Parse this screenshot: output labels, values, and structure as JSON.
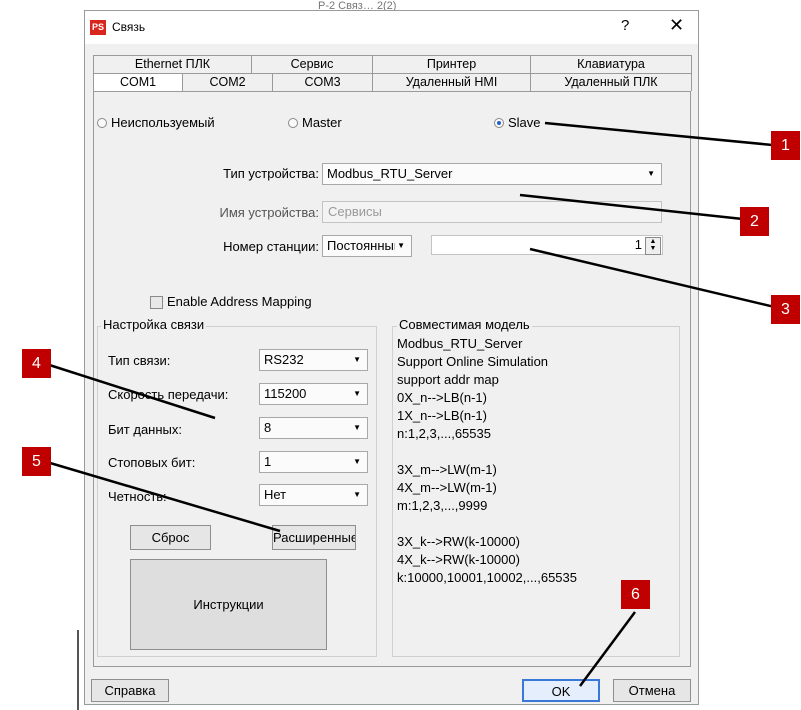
{
  "window": {
    "title": "Связь",
    "help": "?",
    "close": "✕",
    "icon_text": "PS"
  },
  "bg_fragment": "Р-2 Связ… 2(2)",
  "tabs_top": [
    "Ethernet ПЛК",
    "Сервис",
    "Принтер",
    "Клавиатура"
  ],
  "tabs_bottom": [
    "COM1",
    "COM2",
    "COM3",
    "Удаленный HMI",
    "Удаленный ПЛК"
  ],
  "mode": {
    "unused": "Неиспользуемый",
    "master": "Master",
    "slave": "Slave",
    "selected": "Slave"
  },
  "device_type": {
    "label": "Тип устройства:",
    "value": "Modbus_RTU_Server"
  },
  "device_name": {
    "label": "Имя устройства:",
    "value": "Сервисы"
  },
  "station": {
    "label": "Номер станции:",
    "mode": "Постоянный",
    "value": "1"
  },
  "address_mapping": {
    "label": "Enable Address Mapping",
    "checked": false
  },
  "comm_settings": {
    "title": "Настройка связи",
    "type_label": "Тип связи:",
    "type_value": "RS232",
    "baud_label": "Скорость передачи:",
    "baud_value": "115200",
    "databits_label": "Бит данных:",
    "databits_value": "8",
    "stopbits_label": "Стоповых бит:",
    "stopbits_value": "1",
    "parity_label": "Четность:",
    "parity_value": "Нет",
    "reset_button": "Сброс",
    "advanced_button": "Расширенные",
    "instructions_button": "Инструкции"
  },
  "compat": {
    "title": "Совместимая модель",
    "lines": [
      "Modbus_RTU_Server",
      "Support Online Simulation",
      "support addr map",
      "0X_n-->LB(n-1)",
      "1X_n-->LB(n-1)",
      "n:1,2,3,...,65535",
      "",
      "3X_m-->LW(m-1)",
      "4X_m-->LW(m-1)",
      "m:1,2,3,...,9999",
      "",
      "3X_k-->RW(k-10000)",
      "4X_k-->RW(k-10000)",
      "k:10000,10001,10002,...,65535"
    ]
  },
  "footer": {
    "help_button": "Справка",
    "ok_button": "OK",
    "cancel_button": "Отмена"
  },
  "callouts": [
    "1",
    "2",
    "3",
    "4",
    "5",
    "6"
  ],
  "colors": {
    "callout": "#c00000",
    "radio_selected": "#2563c9",
    "dialog_bg": "#f0f0f0"
  }
}
